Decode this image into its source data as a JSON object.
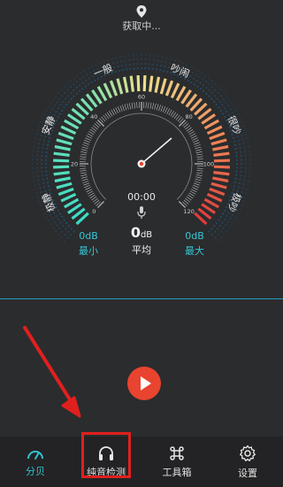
{
  "location": {
    "status": "获取中..."
  },
  "gauge": {
    "zone_labels": [
      "极静",
      "安静",
      "一般",
      "吵闹",
      "很吵",
      "极吵"
    ],
    "scale_labels": [
      "0",
      "20",
      "40",
      "60",
      "80",
      "100",
      "120"
    ],
    "needle_value": 82,
    "timer": "00:00"
  },
  "stats": {
    "min": {
      "value": "0dB",
      "label": "最小"
    },
    "avg": {
      "value": "0",
      "unit": "dB",
      "label": "平均"
    },
    "max": {
      "value": "0dB",
      "label": "最大"
    }
  },
  "tabs": [
    {
      "label": "分贝",
      "icon": "gauge-icon",
      "active": true
    },
    {
      "label": "纯音检测",
      "icon": "headphones-icon",
      "active": false
    },
    {
      "label": "工具箱",
      "icon": "command-icon",
      "active": false
    },
    {
      "label": "设置",
      "icon": "gear-icon",
      "active": false
    }
  ],
  "colors": {
    "accent": "#2fc2cf",
    "play": "#e8442f",
    "highlight": "#e0201e"
  }
}
